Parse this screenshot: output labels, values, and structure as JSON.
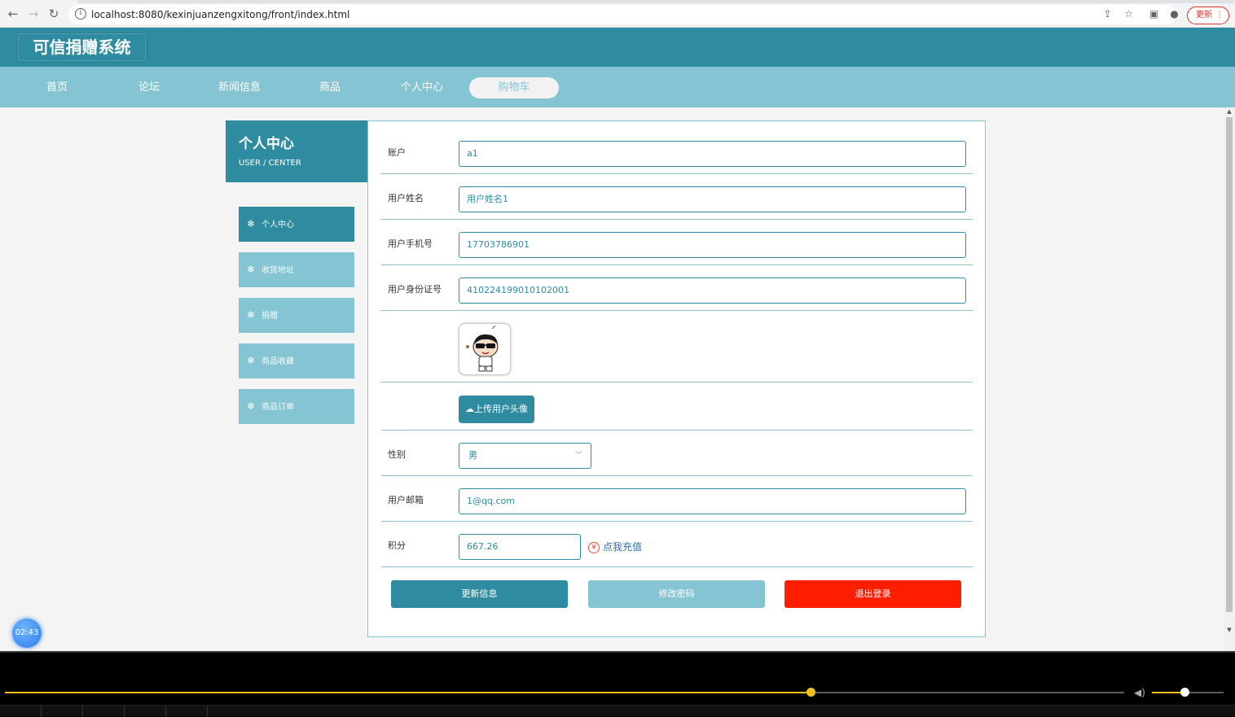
{
  "browser": {
    "url": "localhost:8080/kexinjuanzengxitong/front/index.html",
    "update_label": "更新"
  },
  "site": {
    "logo": "可信捐赠系统",
    "nav": [
      "首页",
      "论坛",
      "新闻信息",
      "商品",
      "个人中心",
      "购物车"
    ]
  },
  "sidebar": {
    "title": "个人中心",
    "subtitle": "USER / CENTER",
    "items": [
      "个人中心",
      "收货地址",
      "捐赠",
      "商品收藏",
      "商品订单"
    ]
  },
  "form": {
    "account_label": "账户",
    "account_value": "a1",
    "name_label": "用户姓名",
    "name_value": "用户姓名1",
    "phone_label": "用户手机号",
    "phone_value": "17703786901",
    "id_label": "用户身份证号",
    "id_value": "410224199010102001",
    "upload_label": "上传用户头像",
    "gender_label": "性别",
    "gender_value": "男",
    "email_label": "用户邮箱",
    "email_value": "1@qq.com",
    "points_label": "积分",
    "points_value": "667.26",
    "recharge_label": "点我充值"
  },
  "actions": {
    "update": "更新信息",
    "change_password": "修改密码",
    "logout": "退出登录"
  },
  "timer": "02:43",
  "player": {
    "progress": 0.72,
    "volume": 0.45
  },
  "colors": {
    "primary": "#2f8ca0",
    "secondary": "#85c4d2",
    "danger": "#ff1f00",
    "recharge": "#2f6fb0"
  }
}
